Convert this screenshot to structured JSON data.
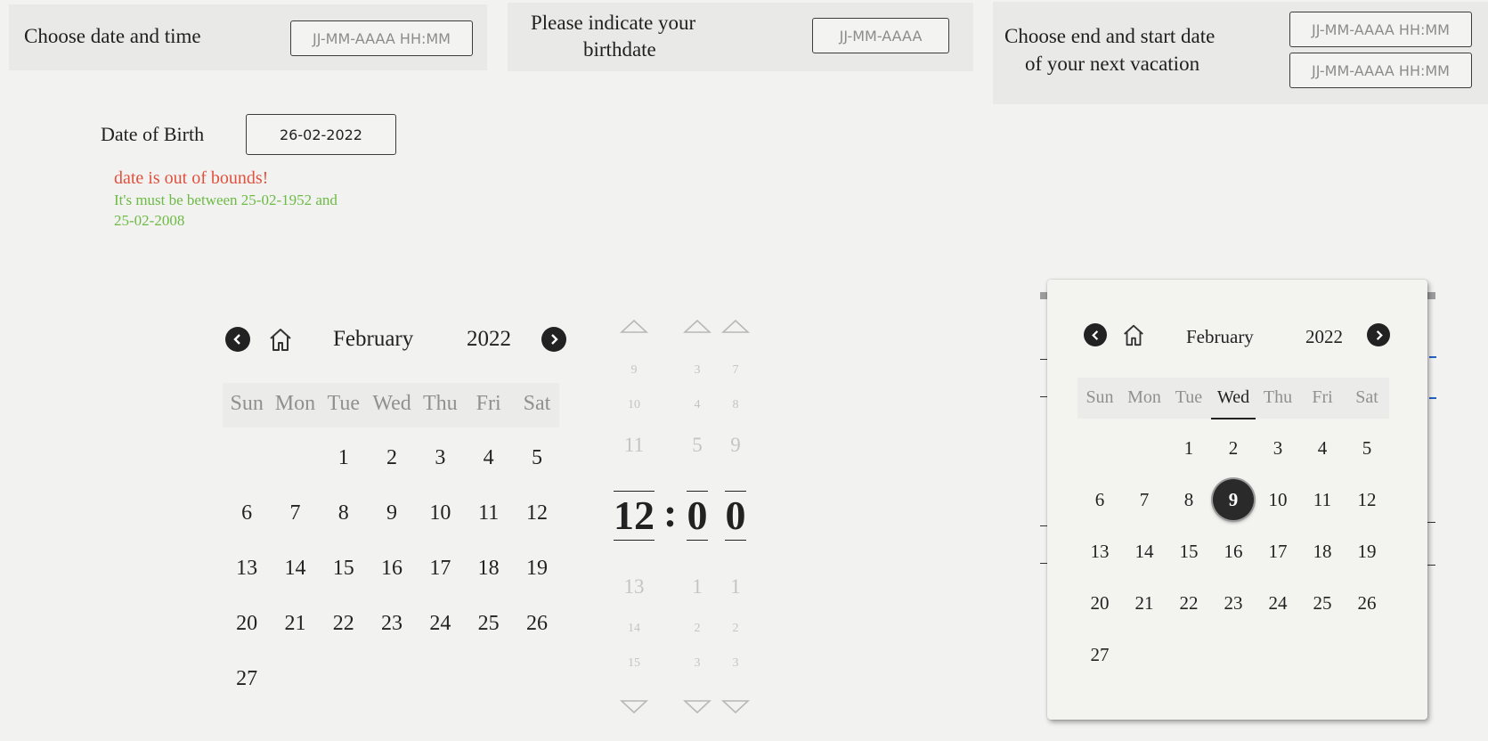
{
  "pickers": {
    "datetime": {
      "label": "Choose date and time",
      "placeholder": "JJ-MM-AAAA HH:MM"
    },
    "birthdate": {
      "label_line1": "Please indicate your",
      "label_line2": "birthdate",
      "placeholder": "JJ-MM-AAAA"
    },
    "vacation": {
      "label_line1": "Choose end and start date",
      "label_line2": "of your next vacation",
      "placeholder_start": "JJ-MM-AAAA HH:MM",
      "placeholder_end": "JJ-MM-AAAA HH:MM"
    }
  },
  "dob": {
    "label": "Date of Birth",
    "value": "26-02-2022",
    "error": "date is out of bounds!",
    "hint_line1": "It's must be between 25-02-1952 and",
    "hint_line2": "25-02-2008"
  },
  "calendar": {
    "month": "February",
    "year": "2022",
    "weekdays": [
      "Sun",
      "Mon",
      "Tue",
      "Wed",
      "Thu",
      "Fri",
      "Sat"
    ],
    "days": [
      "1",
      "2",
      "3",
      "4",
      "5",
      "6",
      "7",
      "8",
      "9",
      "10",
      "11",
      "12",
      "13",
      "14",
      "15",
      "16",
      "17",
      "18",
      "19",
      "20",
      "21",
      "22",
      "23",
      "24",
      "25",
      "26",
      "27"
    ],
    "first_weekday_index": 2
  },
  "time_picker": {
    "hours": [
      "9",
      "10",
      "11",
      "12",
      "13",
      "14",
      "15"
    ],
    "minutes_tens": [
      "3",
      "4",
      "5",
      "0",
      "1",
      "2",
      "3"
    ],
    "minutes_units": [
      "7",
      "8",
      "9",
      "0",
      "1",
      "2",
      "3"
    ],
    "colon": ":"
  },
  "popup": {
    "month": "February",
    "year": "2022",
    "selected_day": "9",
    "highlighted_weekday": "Wed"
  },
  "colors": {
    "error": "#e0523f",
    "hint": "#6dba45",
    "accent": "#2a2a2a"
  }
}
